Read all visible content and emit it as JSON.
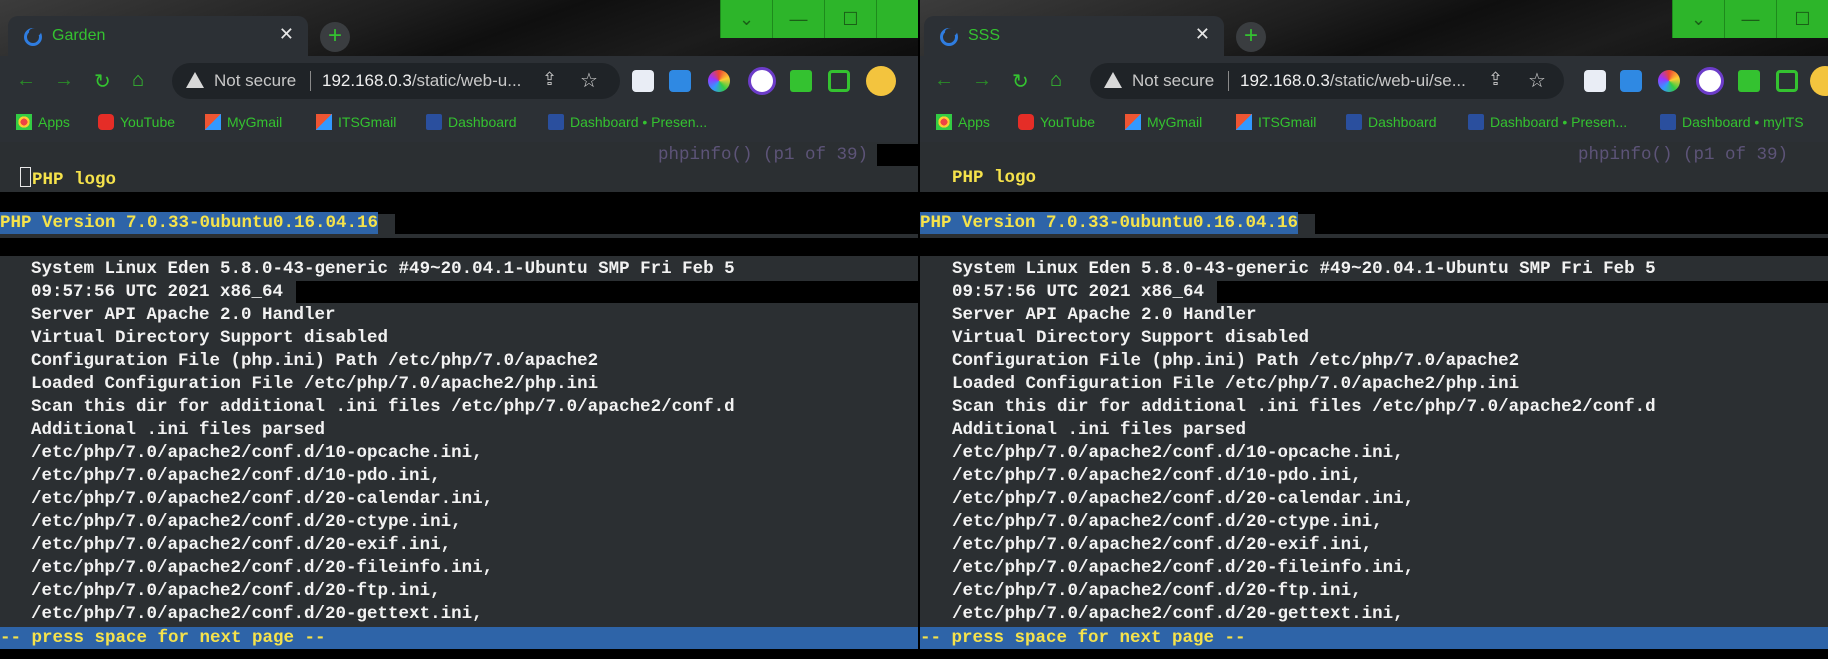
{
  "windows": [
    {
      "tab_title": "Garden",
      "url_prefix": "192.168.0.3",
      "url_path": "/static/web-u...",
      "not_secure": "Not secure",
      "bookmarks": [
        "Apps",
        "YouTube",
        "MyGmail",
        "ITSGmail",
        "Dashboard",
        "Dashboard • Presen..."
      ],
      "terminal": {
        "pager_header": "phpinfo() (p1 of 39)",
        "logo_line": "PHP logo",
        "version_line": "PHP Version 7.0.33-0ubuntu0.16.04.16",
        "lines": [
          "System Linux Eden 5.8.0-43-generic #49~20.04.1-Ubuntu SMP Fri Feb 5",
          "09:57:56 UTC 2021 x86_64",
          "Server API Apache 2.0 Handler",
          "Virtual Directory Support disabled",
          "Configuration File (php.ini) Path /etc/php/7.0/apache2",
          "Loaded Configuration File /etc/php/7.0/apache2/php.ini",
          "Scan this dir for additional .ini files /etc/php/7.0/apache2/conf.d",
          "Additional .ini files parsed",
          "/etc/php/7.0/apache2/conf.d/10-opcache.ini,",
          "/etc/php/7.0/apache2/conf.d/10-pdo.ini,",
          "/etc/php/7.0/apache2/conf.d/20-calendar.ini,",
          "/etc/php/7.0/apache2/conf.d/20-ctype.ini,",
          "/etc/php/7.0/apache2/conf.d/20-exif.ini,",
          "/etc/php/7.0/apache2/conf.d/20-fileinfo.ini,",
          "/etc/php/7.0/apache2/conf.d/20-ftp.ini,",
          "/etc/php/7.0/apache2/conf.d/20-gettext.ini,"
        ],
        "status_line": "-- press space for next page --"
      }
    },
    {
      "tab_title": "SSS",
      "url_prefix": "192.168.0.3",
      "url_path": "/static/web-ui/se...",
      "not_secure": "Not secure",
      "bookmarks": [
        "Apps",
        "YouTube",
        "MyGmail",
        "ITSGmail",
        "Dashboard",
        "Dashboard • Presen...",
        "Dashboard • myITS"
      ],
      "terminal": {
        "pager_header": "phpinfo() (p1 of 39)",
        "logo_line": "PHP logo",
        "version_line": "PHP Version 7.0.33-0ubuntu0.16.04.16",
        "lines": [
          "System Linux Eden 5.8.0-43-generic #49~20.04.1-Ubuntu SMP Fri Feb 5",
          "09:57:56 UTC 2021 x86_64",
          "Server API Apache 2.0 Handler",
          "Virtual Directory Support disabled",
          "Configuration File (php.ini) Path /etc/php/7.0/apache2",
          "Loaded Configuration File /etc/php/7.0/apache2/php.ini",
          "Scan this dir for additional .ini files /etc/php/7.0/apache2/conf.d",
          "Additional .ini files parsed",
          "/etc/php/7.0/apache2/conf.d/10-opcache.ini,",
          "/etc/php/7.0/apache2/conf.d/10-pdo.ini,",
          "/etc/php/7.0/apache2/conf.d/20-calendar.ini,",
          "/etc/php/7.0/apache2/conf.d/20-ctype.ini,",
          "/etc/php/7.0/apache2/conf.d/20-exif.ini,",
          "/etc/php/7.0/apache2/conf.d/20-fileinfo.ini,",
          "/etc/php/7.0/apache2/conf.d/20-ftp.ini,",
          "/etc/php/7.0/apache2/conf.d/20-gettext.ini,"
        ],
        "status_line": "-- press space for next page --"
      }
    }
  ],
  "icons": {
    "close": "✕",
    "new_tab": "+",
    "back": "←",
    "forward": "→",
    "reload": "↻",
    "home": "⌂",
    "star": "☆",
    "share": "⇪",
    "minimize": "—",
    "maximize": "☐",
    "dropdown": "⌄"
  },
  "colors": {
    "accent_green": "#34c230",
    "terminal_yellow": "#f5e24b",
    "highlight_blue": "#2e64a8",
    "terminal_bg": "#2b2f32"
  }
}
